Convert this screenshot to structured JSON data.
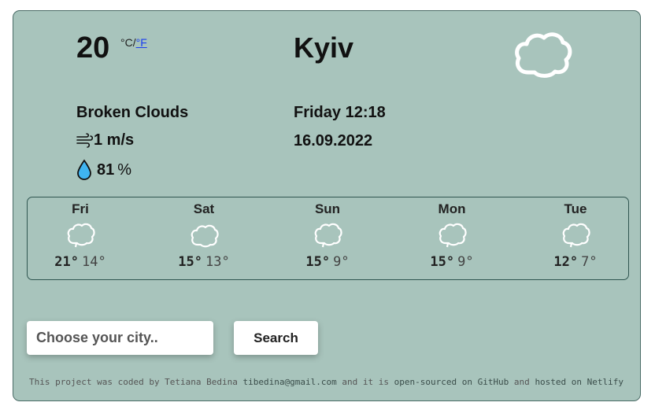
{
  "current": {
    "temperature": "20",
    "unit_celsius": "°C",
    "unit_separator": "/",
    "unit_fahrenheit": "°F",
    "city": "Kyiv",
    "description": "Broken Clouds",
    "wind": "1 m/s",
    "humidity_value": "81",
    "humidity_unit": "%",
    "day_time": "Friday 12:18",
    "date": "16.09.2022",
    "icon": "cloud-icon"
  },
  "forecast": [
    {
      "day": "Fri",
      "max": "21°",
      "min": "14°",
      "icon": "cloud-icon"
    },
    {
      "day": "Sat",
      "max": "15°",
      "min": "13°",
      "icon": "cloud-icon"
    },
    {
      "day": "Sun",
      "max": "15°",
      "min": "9°",
      "icon": "cloud-icon"
    },
    {
      "day": "Mon",
      "max": "15°",
      "min": "9°",
      "icon": "cloud-icon"
    },
    {
      "day": "Tue",
      "max": "12°",
      "min": "7°",
      "icon": "cloud-icon"
    }
  ],
  "search": {
    "placeholder": "Choose your city..",
    "button_label": "Search"
  },
  "footer": {
    "text1": "This project was coded by Tetiana Bedina ",
    "email": "tibedina@gmail.com",
    "text2": " and it is ",
    "source_link": "open-sourced on GitHub",
    "text3": " and ",
    "hosted_link": "hosted on Netlify"
  },
  "colors": {
    "card_background": "#a8c4bc",
    "link": "#1a3ef0"
  }
}
